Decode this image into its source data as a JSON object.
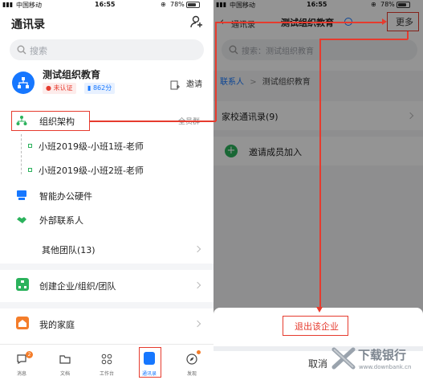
{
  "status": {
    "carrier": "中国移动",
    "time": "16:55",
    "battery": "78%",
    "battery_level": 0.78
  },
  "left": {
    "title": "通讯录",
    "search_placeholder": "搜索",
    "org": {
      "name": "测试组织教育",
      "badge_unverified": "未认证",
      "badge_score": "862分",
      "invite_label": "邀请"
    },
    "structure_label": "组织架构",
    "all_members_label": "全员群",
    "sub_items": [
      "小班2019级-小班1班-老师",
      "小班2019级-小班2班-老师"
    ],
    "smart_office_label": "智能办公硬件",
    "external_contacts_label": "外部联系人",
    "other_teams_label": "其他团队(13)",
    "create_label": "创建企业/组织/团队",
    "family_label": "我的家庭",
    "tabs": [
      {
        "label": "消息",
        "badge": "2"
      },
      {
        "label": "文档"
      },
      {
        "label": "工作台"
      },
      {
        "label": "通讯录",
        "active": true
      },
      {
        "label": "发现"
      }
    ]
  },
  "right": {
    "back_label": "通讯录",
    "title": "测试组织教育",
    "more_label": "更多",
    "search_placeholder": "搜索：测试组织教育",
    "breadcrumb_root": "联系人",
    "breadcrumb_separator": ">",
    "breadcrumb_current": "测试组织教育",
    "home_school_label": "家校通讯录(9)",
    "invite_members_label": "邀请成员加入",
    "exit_label": "退出该企业",
    "cancel_label": "取消"
  },
  "watermark": {
    "brand": "下载银行",
    "url": "www.downbank.cn"
  },
  "colors": {
    "accent": "#1677ff",
    "highlight": "#e63b2e",
    "green": "#2bb25c"
  }
}
